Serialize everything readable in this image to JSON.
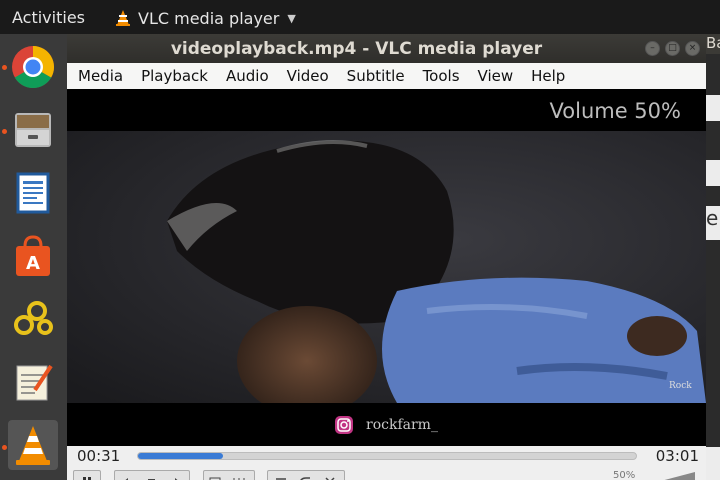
{
  "topbar": {
    "activities": "Activities",
    "app_name": "VLC media player"
  },
  "dock": {
    "items": [
      {
        "name": "chrome-icon",
        "active": false
      },
      {
        "name": "files-icon",
        "active": false
      },
      {
        "name": "writer-icon",
        "active": false
      },
      {
        "name": "software-center-icon",
        "active": false
      },
      {
        "name": "settings-icon",
        "active": false
      },
      {
        "name": "text-editor-icon",
        "active": false
      },
      {
        "name": "vlc-icon",
        "active": true
      }
    ]
  },
  "window": {
    "title": "videoplayback.mp4 - VLC media player",
    "menu": [
      "Media",
      "Playback",
      "Audio",
      "Video",
      "Subtitle",
      "Tools",
      "View",
      "Help"
    ],
    "osd": "Volume 50%",
    "watermark": "rockfarm_",
    "time_current": "00:31",
    "time_total": "03:01",
    "progress_fraction": 0.17,
    "volume_label": "50%"
  },
  "colors": {
    "accent": "#e95420",
    "seek_fill": "#3a7bd5"
  }
}
